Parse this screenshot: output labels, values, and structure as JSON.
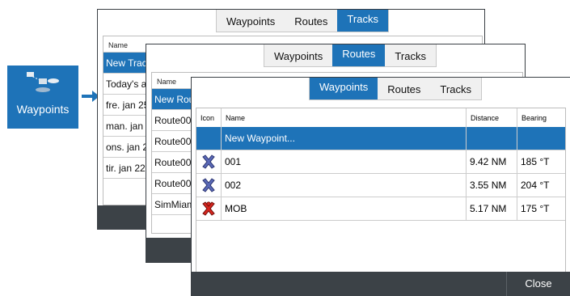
{
  "tile": {
    "label": "Waypoints",
    "icon": "waypoints-icon"
  },
  "back_window": {
    "tabs": [
      "Waypoints",
      "Routes",
      "Tracks"
    ],
    "active_tab": "Tracks",
    "column": "Name",
    "rows": [
      "New Track...",
      "Today's ac",
      "fre. jan 25",
      "man. jan 2",
      "ons. jan 23",
      "tir. jan 22"
    ]
  },
  "middle_window": {
    "tabs": [
      "Waypoints",
      "Routes",
      "Tracks"
    ],
    "active_tab": "Routes",
    "column": "Name",
    "rows": [
      "New Rout",
      "Route001",
      "Route002",
      "Route003",
      "Route004",
      "SimMiam"
    ]
  },
  "front_window": {
    "tabs": [
      "Waypoints",
      "Routes",
      "Tracks"
    ],
    "active_tab": "Waypoints",
    "columns": {
      "icon": "Icon",
      "name": "Name",
      "distance": "Distance",
      "bearing": "Bearing"
    },
    "rows": [
      {
        "icon": "",
        "name": "New Waypoint...",
        "distance": "",
        "bearing": ""
      },
      {
        "icon": "waypoint-cross-blue-icon",
        "name": "001",
        "distance": "9.42 NM",
        "bearing": "185 °T"
      },
      {
        "icon": "waypoint-cross-blue-icon",
        "name": "002",
        "distance": "3.55 NM",
        "bearing": "204 °T"
      },
      {
        "icon": "mob-cross-red-icon",
        "name": "MOB",
        "distance": "5.17 NM",
        "bearing": "175 °T"
      }
    ],
    "close_label": "Close"
  },
  "colors": {
    "accent": "#1e73b8",
    "bar": "#3c4247",
    "mob": "#d7261e",
    "waypoint": "#3a4a9a"
  }
}
